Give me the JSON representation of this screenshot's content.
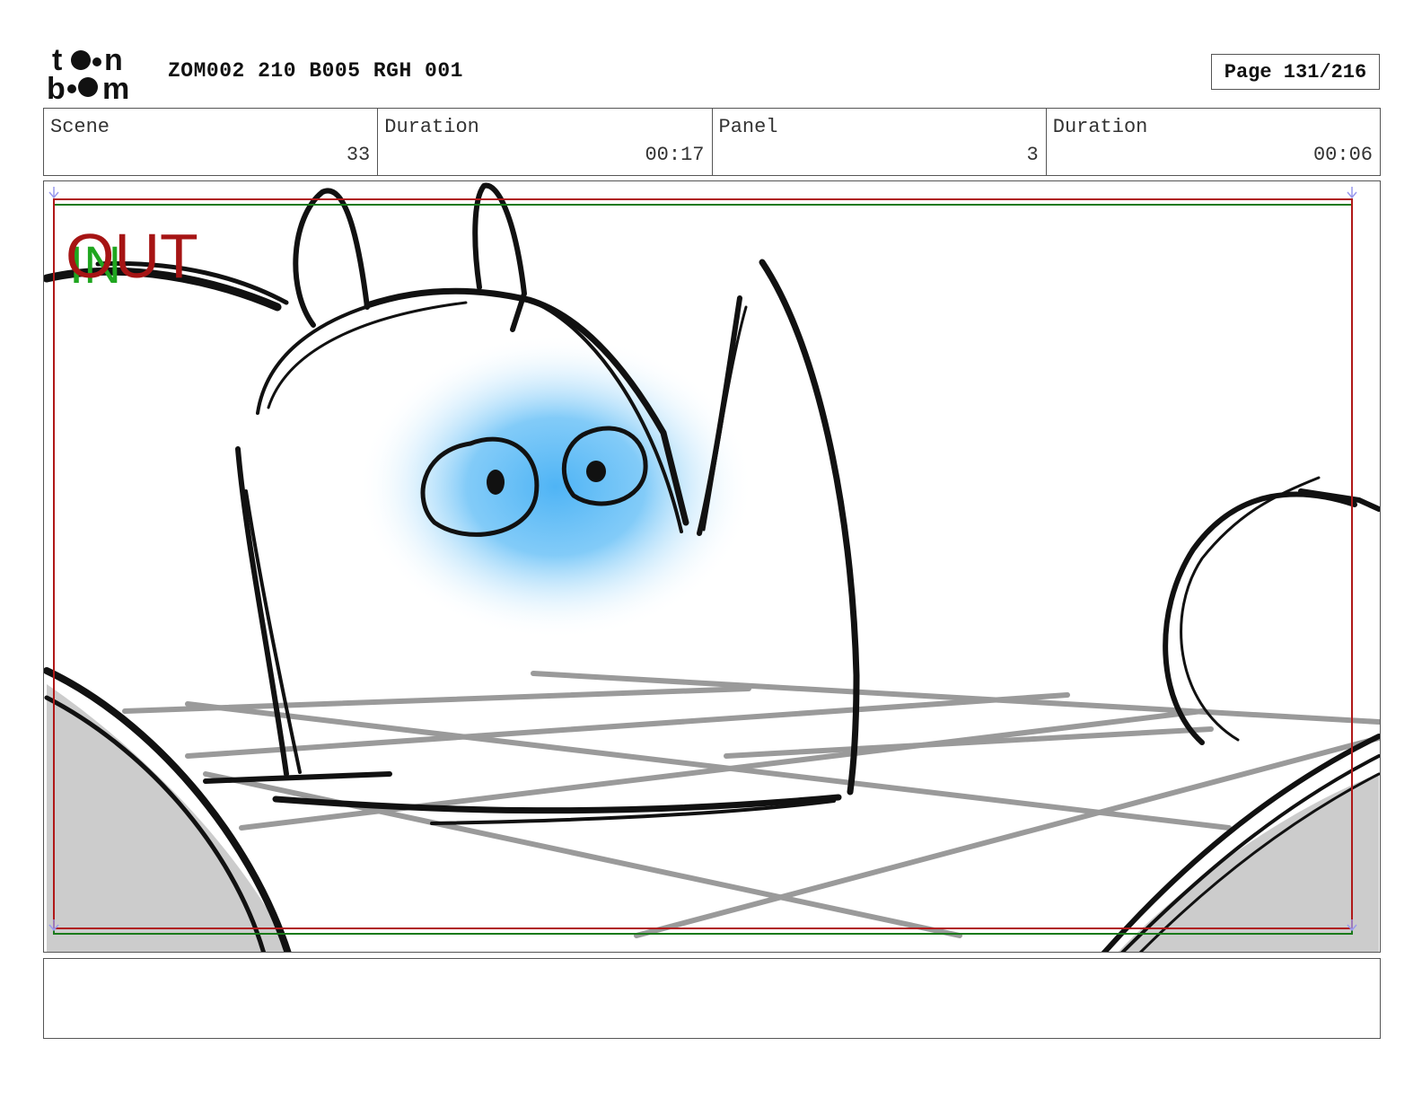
{
  "header": {
    "logo_text": "toon boom",
    "title": "ZOM002 210 B005 RGH 001",
    "page_label": "Page 131/216"
  },
  "info": {
    "scene_label": "Scene",
    "scene_value": "33",
    "scene_duration_label": "Duration",
    "scene_duration_value": "00:17",
    "panel_label": "Panel",
    "panel_value": "3",
    "panel_duration_label": "Duration",
    "panel_duration_value": "00:06"
  },
  "panel": {
    "overlay_in": "IN",
    "overlay_out": "OUT",
    "colors": {
      "out_frame": "#b01818",
      "in_frame": "#1a7a1a",
      "eye_glow": "#4fb4f5",
      "floor_grid": "#9a9a9a",
      "shadow_fill": "#cccccc"
    }
  },
  "notes": {
    "text": ""
  }
}
